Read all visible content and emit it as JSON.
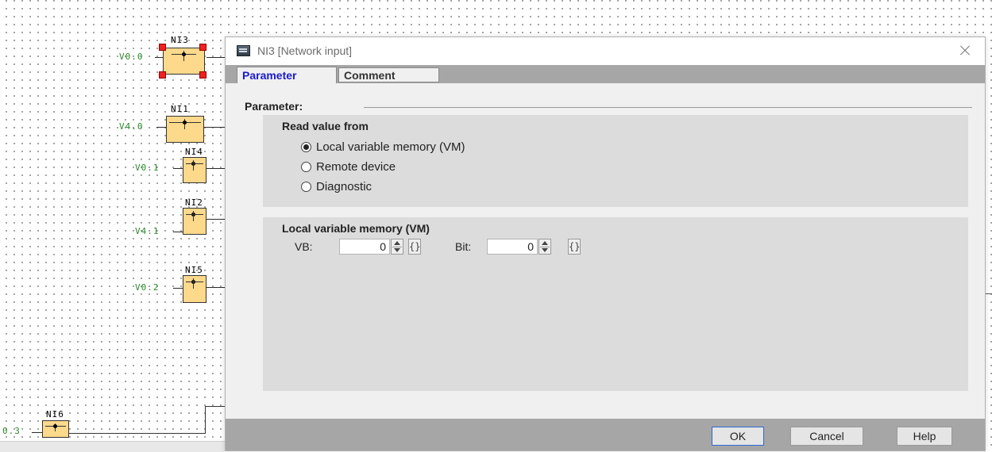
{
  "canvas": {
    "blocks": [
      {
        "id": "NI3",
        "title": "NI3",
        "label": "V0.0",
        "selected": true
      },
      {
        "id": "NI1",
        "title": "NI1",
        "label": "V4.0",
        "selected": false
      },
      {
        "id": "NI4",
        "title": "NI4",
        "label": "V0.1",
        "selected": false
      },
      {
        "id": "NI2",
        "title": "NI2",
        "label": "V4.1",
        "selected": false
      },
      {
        "id": "NI5",
        "title": "NI5",
        "label": "V0.2",
        "selected": false
      },
      {
        "id": "NI6",
        "title": "NI6",
        "label": "0.3",
        "selected": false
      }
    ]
  },
  "dialog": {
    "title": "NI3 [Network input]",
    "tabs": [
      {
        "label": "Parameter",
        "active": true
      },
      {
        "label": "Comment",
        "active": false
      }
    ],
    "section_label": "Parameter:",
    "read_group": {
      "title": "Read value from",
      "options": [
        {
          "label": "Local variable memory (VM)",
          "checked": true
        },
        {
          "label": "Remote device",
          "checked": false
        },
        {
          "label": "Diagnostic",
          "checked": false
        }
      ]
    },
    "vm_group": {
      "title": "Local variable memory (VM)",
      "vb_label": "VB:",
      "vb_value": "0",
      "bit_label": "Bit:",
      "bit_value": "0",
      "brace_glyph": "{}"
    },
    "buttons": {
      "ok": "OK",
      "cancel": "Cancel",
      "help": "Help"
    }
  },
  "colors": {
    "accent": "#1a1acf",
    "block_fill": "#fcd98b",
    "label_green": "#2a8a2a",
    "handle_red": "#ee2222"
  }
}
